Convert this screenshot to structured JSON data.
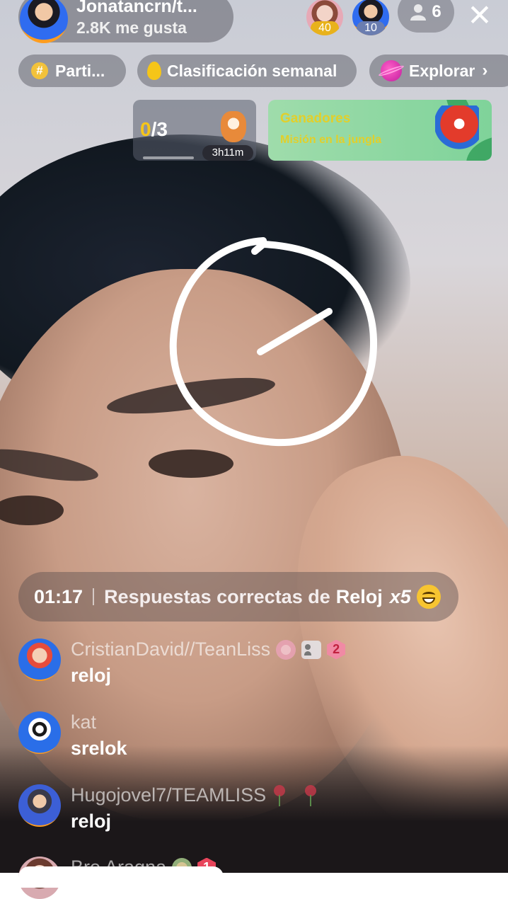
{
  "host": {
    "name": "Jonatancrn/t...",
    "likes": "2.8K me gusta",
    "avatar_icon": "team-avatar-icon"
  },
  "top_viewers": [
    {
      "badge": "40",
      "badge_color": "#e8b21c"
    },
    {
      "badge": "10",
      "badge_color": "#6a7db0"
    }
  ],
  "viewer_count": "6",
  "close_icon": "✕",
  "pills": {
    "participate": "Parti...",
    "weekly_ranking": "Clasificación semanal",
    "explore": "Explorar",
    "explore_chevron": "›"
  },
  "task": {
    "done": "0",
    "total": "/3",
    "time": "3h11m",
    "progress": 0
  },
  "banner": {
    "title": "Ganadores",
    "subtitle": "Misión en la jungla"
  },
  "quiz": {
    "time": "01:17",
    "text": "Respuestas correctas de",
    "word": "Reloj",
    "multiplier": "x5"
  },
  "comments": [
    {
      "user": "CristianDavid//TeanLiss",
      "message": "reloj",
      "rank": "2"
    },
    {
      "user": "kat",
      "message": "srelok"
    },
    {
      "user": "Hugojovel7/TEAMLISS",
      "message": "reloj"
    },
    {
      "user": "Bre Aragna",
      "message": "",
      "rank": "1"
    }
  ],
  "colors": {
    "accent_yellow": "#f5c518",
    "banner_green": "#8fd8a2",
    "banner_text": "#e2cf2a"
  }
}
